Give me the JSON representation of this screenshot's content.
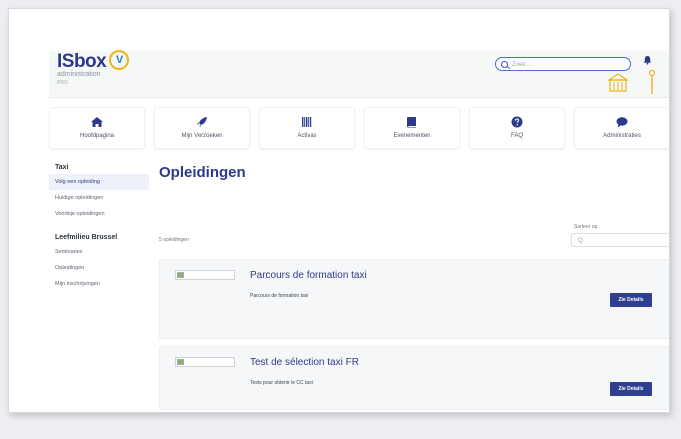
{
  "header": {
    "logo": "ISbox",
    "logo_badge": "V",
    "subtitle": "administration",
    "subtitle2": "PRO",
    "search_placeholder": "Zoek...",
    "colors": {
      "brand": "#2d3a8c",
      "accent": "#f2b21c"
    }
  },
  "nav": [
    {
      "label": "Hoofdpagina",
      "icon": "home-icon"
    },
    {
      "label": "Mijn Verzoeken",
      "icon": "rocket-icon"
    },
    {
      "label": "Activas",
      "icon": "barcode-icon"
    },
    {
      "label": "Evenementen",
      "icon": "book-icon"
    },
    {
      "label": "FAQ",
      "icon": "question-icon"
    },
    {
      "label": "Administraties",
      "icon": "chat-icon"
    }
  ],
  "sidebar": {
    "section1": "Taxi",
    "items1": [
      "Volg een opleiding",
      "Huidige opleidingen",
      "Voorbije opleidingen"
    ],
    "section2": "Leefmilieu Brussel",
    "items2": [
      "Seminaries",
      "Opleidingen",
      "Mijn inschrijvingen"
    ]
  },
  "main": {
    "title": "Opleidingen",
    "count": "5 opleidingen",
    "sort_label": "Sorteer op",
    "sort_placeholder": "Q"
  },
  "courses": [
    {
      "title": "Parcours de formation taxi",
      "desc": "Parcours de formation taxi",
      "button": "Zie Details"
    },
    {
      "title": "Test de sélection taxi FR",
      "desc": "Tests pour obtenir le CC taxi",
      "button": "Zie Details"
    }
  ]
}
